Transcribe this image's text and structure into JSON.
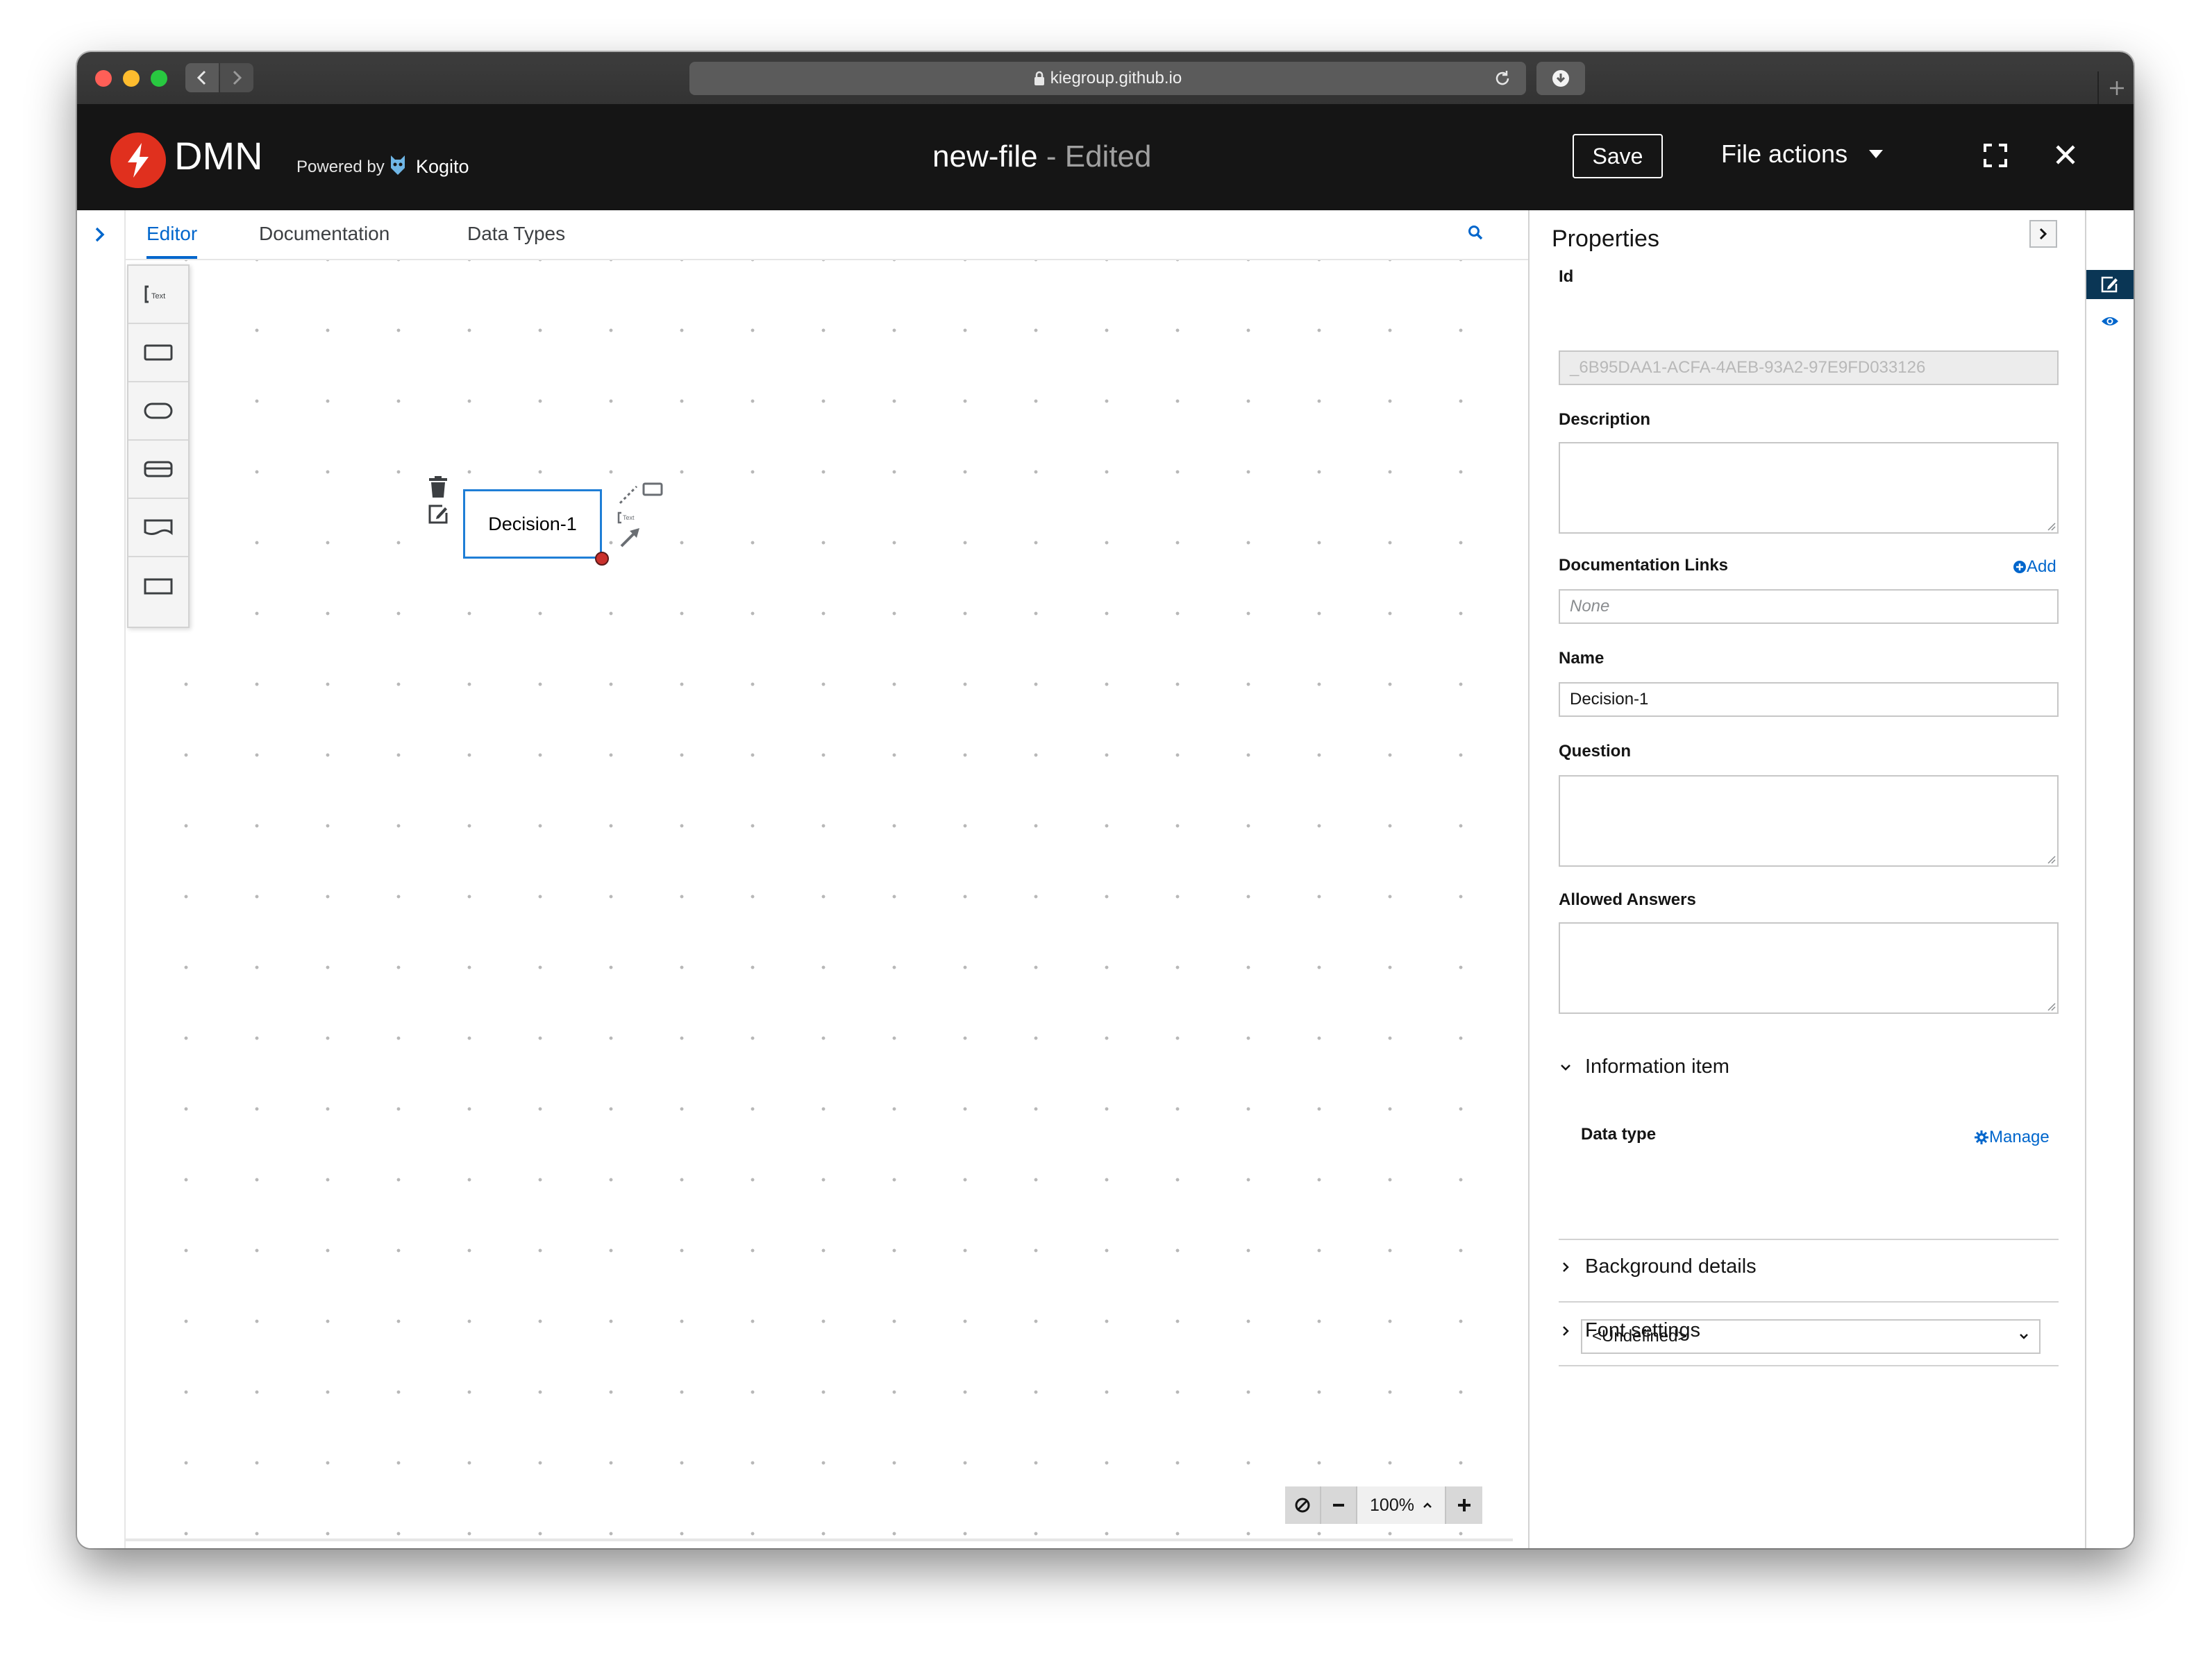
{
  "browser": {
    "url": "kiegroup.github.io"
  },
  "header": {
    "app_name": "DMN",
    "powered_by": "Powered by",
    "kogito": "Kogito",
    "file_name": "new-file",
    "edited_label": "- Edited",
    "save_label": "Save",
    "file_actions_label": "File actions",
    "logo_color": "#e0301e"
  },
  "tabs": [
    {
      "label": "Editor",
      "active": true
    },
    {
      "label": "Documentation",
      "active": false
    },
    {
      "label": "Data Types",
      "active": false
    }
  ],
  "palette": [
    {
      "icon": "text-annotation-icon"
    },
    {
      "icon": "decision-icon"
    },
    {
      "icon": "input-data-icon"
    },
    {
      "icon": "business-knowledge-model-icon"
    },
    {
      "icon": "knowledge-source-icon"
    },
    {
      "icon": "decision-service-icon"
    }
  ],
  "canvas": {
    "decision_node_label": "Decision-1",
    "zoom": "100%"
  },
  "properties": {
    "title": "Properties",
    "id_label": "Id",
    "id_value": "_6B95DAA1-ACFA-4AEB-93A2-97E9FD033126",
    "description_label": "Description",
    "description_value": "",
    "doc_links_label": "Documentation Links",
    "add_label": "Add",
    "doc_links_placeholder": "None",
    "name_label": "Name",
    "name_value": "Decision-1",
    "question_label": "Question",
    "question_value": "",
    "allowed_answers_label": "Allowed Answers",
    "allowed_answers_value": "",
    "information_item_label": "Information item",
    "data_type_label": "Data type",
    "manage_label": "Manage",
    "data_type_value": "<Undefined>",
    "background_details_label": "Background details",
    "font_settings_label": "Font settings"
  },
  "colors": {
    "accent": "#0066cc",
    "header_bg": "#151515",
    "node_border": "#1f7ed6",
    "active_strip": "#0a3655"
  }
}
